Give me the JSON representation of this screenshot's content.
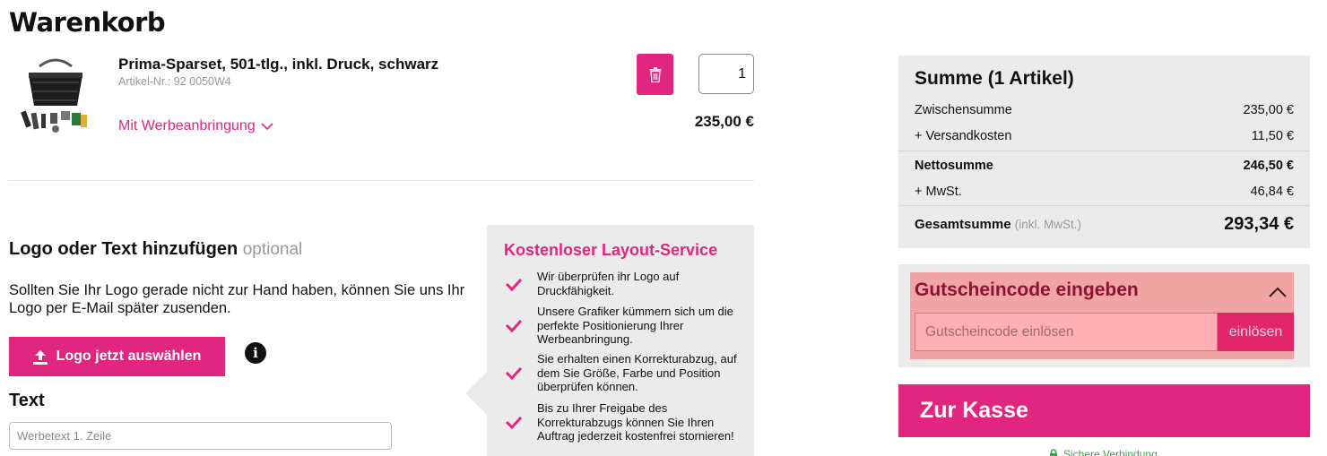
{
  "page": {
    "title": "Warenkorb"
  },
  "product": {
    "name": "Prima-Sparset, 501-tlg., inkl. Druck, schwarz",
    "sku": "Artikel-Nr.: 92 0050W4",
    "option_label": "Mit Werbeanbringung",
    "quantity": "1",
    "price": "235,00 €"
  },
  "logo_section": {
    "heading": "Logo oder Text hinzufügen",
    "optional": "optional",
    "description": "Sollten Sie Ihr Logo gerade nicht zur Hand haben, können Sie uns Ihr Logo per E-Mail später zusenden.",
    "upload_label": "Logo jetzt auswählen",
    "info_glyph": "i",
    "text_heading": "Text",
    "text_placeholder": "Werbetext 1. Zeile"
  },
  "layout_service": {
    "title": "Kostenloser Layout-Service",
    "items": [
      "Wir überprüfen ihr Logo auf Druckfähigkeit.",
      "Unsere Grafiker kümmern sich um die perfekte Positionierung Ihrer Werbeanbringung.",
      "Sie erhalten einen Korrekturabzug, auf dem Sie Größe, Farbe und Position überprüfen können.",
      "Bis zu Ihrer Freigabe des Korrekturabzugs können Sie Ihren Auftrag jederzeit kostenfrei stornieren!"
    ]
  },
  "summary": {
    "title": "Summe (1 Artikel)",
    "subtotal_label": "Zwischensumme",
    "subtotal_value": "235,00 €",
    "shipping_label": "+ Versandkosten",
    "shipping_value": "11,50 €",
    "net_label": "Nettosumme",
    "net_value": "246,50 €",
    "vat_label": "+ MwSt.",
    "vat_value": "46,84 €",
    "total_label": "Gesamtsumme",
    "total_note": "(inkl. MwSt.)",
    "total_value": "293,34 €"
  },
  "voucher": {
    "title": "Gutscheincode eingeben",
    "placeholder": "Gutscheincode einlösen",
    "button_label": "einlösen"
  },
  "checkout": {
    "button_label": "Zur Kasse",
    "secure_label": "Sichere Verbindung"
  },
  "colors": {
    "accent": "#e0267e",
    "panel": "#ebebeb",
    "voucher_highlight": "#f0a4a4",
    "secure_green": "#3aa14b"
  },
  "icons": [
    "product-image",
    "chevron-down-icon",
    "trash-icon",
    "upload-icon",
    "info-icon",
    "check-icon",
    "chevron-up-icon",
    "lock-icon"
  ]
}
